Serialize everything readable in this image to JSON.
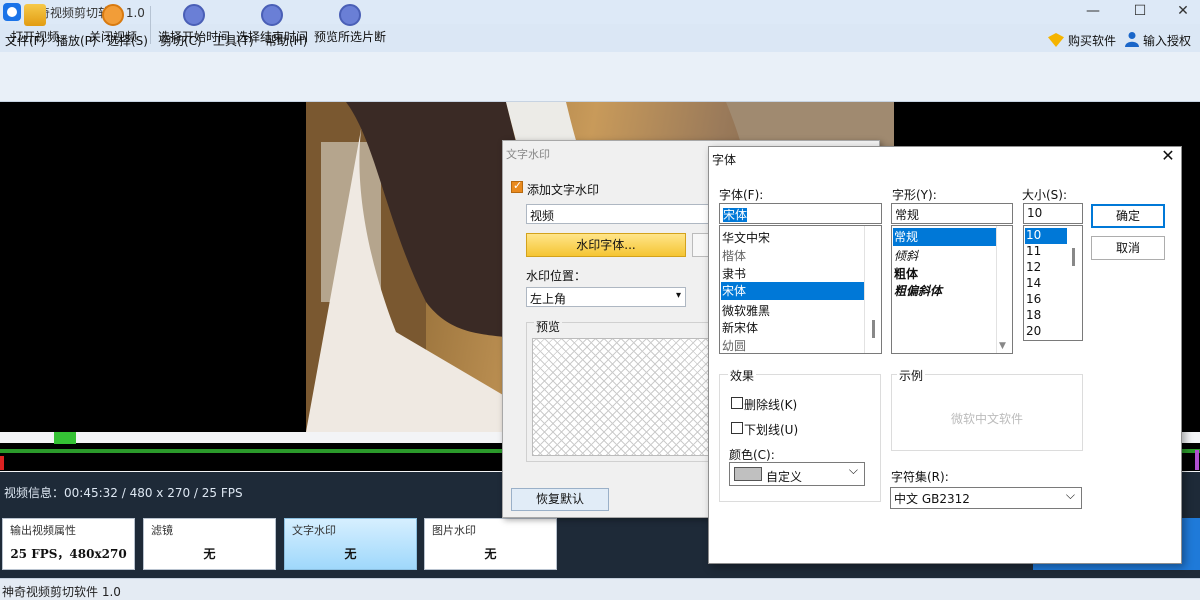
{
  "window": {
    "title": "神奇视频剪切软件 1.0",
    "minimize": "—",
    "maximize": "☐",
    "close": "✕"
  },
  "menu": [
    "文件(F)",
    "播放(P)",
    "选择(S)",
    "剪切(C)",
    "工具(T)",
    "帮助(H)"
  ],
  "header_right": {
    "buy": "购买软件",
    "license": "输入授权码"
  },
  "toolbar": [
    {
      "label": "打开视频",
      "icon": "folder-open-icon",
      "color": "#7bc043"
    },
    {
      "label": "关闭视频",
      "icon": "close-circle-icon",
      "color": "#f29d38"
    },
    {
      "label": "选择开始时间",
      "icon": "bracket-start-icon",
      "color": "#6a7fd6"
    },
    {
      "label": "选择结束时间",
      "icon": "bracket-end-icon",
      "color": "#6a7fd6"
    },
    {
      "label": "预览所选片断",
      "icon": "play-icon",
      "color": "#6a7fd6"
    }
  ],
  "video_info": "视频信息：00:45:32 / 480 x 270 / 25 FPS",
  "cards": [
    {
      "title": "输出视频属性",
      "value": "25 FPS，480x270",
      "active": false
    },
    {
      "title": "滤镜",
      "value": "无",
      "active": false
    },
    {
      "title": "文字水印",
      "value": "无",
      "active": true
    },
    {
      "title": "图片水印",
      "value": "无",
      "active": false
    }
  ],
  "status": "神奇视频剪切软件 1.0",
  "watermark_dialog": {
    "title": "文字水印",
    "enable_label": "添加文字水印",
    "enabled": true,
    "text_value": "视频",
    "font_button": "水印字体...",
    "position_label": "水印位置：",
    "position_value": "左上角",
    "preview_label": "预览",
    "reset_button": "恢复默认"
  },
  "font_dialog": {
    "title": "字体",
    "close": "✕",
    "font_label": "字体(F):",
    "font_value": "宋体",
    "fonts": [
      "华文中宋",
      "楷体",
      "隶书",
      "宋体",
      "微软雅黑",
      "新宋体",
      "幼圆"
    ],
    "selected_font": "宋体",
    "style_label": "字形(Y):",
    "style_value": "常规",
    "styles": [
      "常规",
      "倾斜",
      "粗体",
      "粗偏斜体"
    ],
    "selected_style": "常规",
    "size_label": "大小(S):",
    "size_value": "10",
    "sizes": [
      "10",
      "11",
      "12",
      "14",
      "16",
      "18",
      "20"
    ],
    "selected_size": "10",
    "ok": "确定",
    "cancel": "取消",
    "effects_label": "效果",
    "strikeout_label": "删除线(K)",
    "strikeout": false,
    "underline_label": "下划线(U)",
    "underline": false,
    "color_label": "颜色(C):",
    "color_value": "自定义",
    "color_swatch": "#c0c0c0",
    "sample_label": "示例",
    "sample_text": "微软中文软件",
    "charset_label": "字符集(R):",
    "charset_value": "中文 GB2312"
  }
}
